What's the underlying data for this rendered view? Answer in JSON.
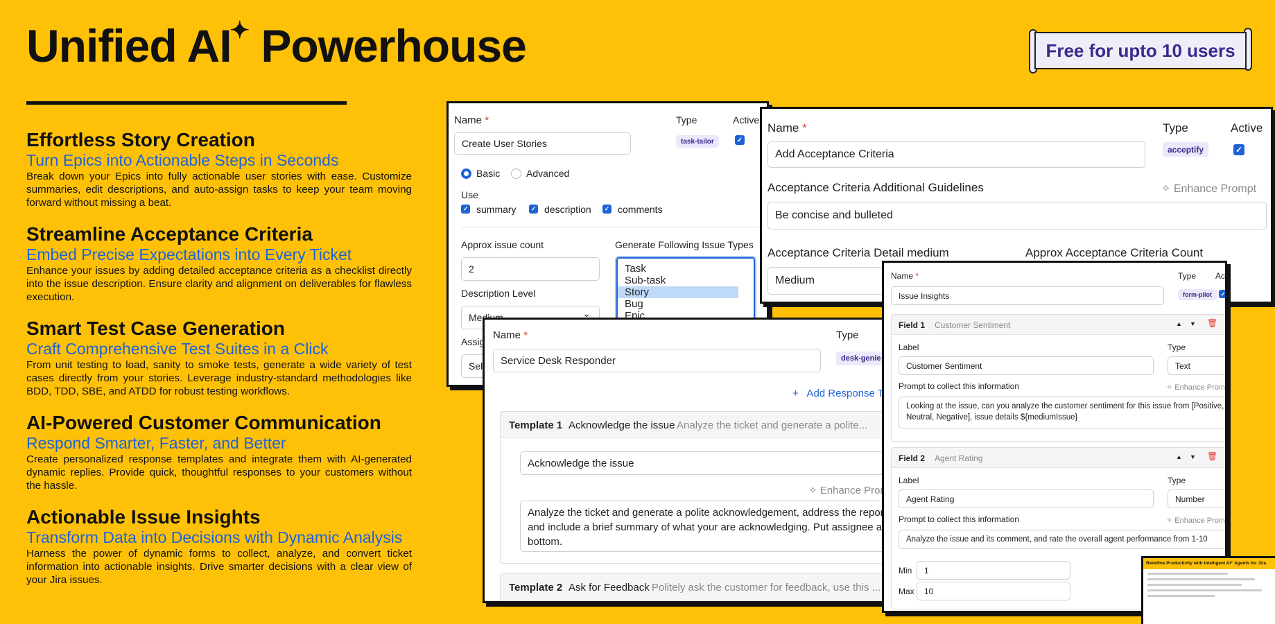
{
  "hero": {
    "title": "Unified AI",
    "sparkle": "✦",
    "title_suffix": " Powerhouse",
    "badge": "Free for upto 10 users"
  },
  "features": [
    {
      "title": "Effortless Story Creation",
      "subtitle": "Turn Epics into Actionable Steps in Seconds",
      "body": "Break down your Epics into fully actionable user stories with ease. Customize summaries, edit descriptions, and auto-assign tasks to keep your team moving forward without missing a beat."
    },
    {
      "title": "Streamline Acceptance Criteria",
      "subtitle": "Embed Precise Expectations into Every Ticket",
      "body": "Enhance your issues by adding detailed acceptance criteria as a checklist directly into the issue description. Ensure clarity and alignment on deliverables for flawless execution."
    },
    {
      "title": "Smart Test Case Generation",
      "subtitle": "Craft Comprehensive Test Suites in a Click",
      "body": "From unit testing to load, sanity to smoke tests, generate a wide variety of test cases directly from your stories. Leverage industry-standard methodologies like BDD, TDD, SBE, and ATDD for robust testing workflows."
    },
    {
      "title": "AI-Powered Customer Communication",
      "subtitle": "Respond Smarter, Faster, and Better",
      "body": "Create personalized response templates and integrate them with AI-generated dynamic replies. Provide quick, thoughtful responses to your customers without the hassle."
    },
    {
      "title": "Actionable Issue Insights",
      "subtitle": "Transform Data into Decisions with Dynamic Analysis",
      "body": "Harness the power of dynamic forms to collect, analyze, and convert ticket information into actionable insights. Drive smarter decisions with a clear view of your Jira issues."
    }
  ],
  "common": {
    "name_label": "Name",
    "required": "*",
    "type_label": "Type",
    "active_label": "Active",
    "check": "✓",
    "enhance_prompt": "Enhance Prompt",
    "sparkle_icon": "✧",
    "chevron": "⌄"
  },
  "story_card": {
    "name_value": "Create User Stories",
    "type_tag": "task-tailor",
    "mode_basic": "Basic",
    "mode_advanced": "Advanced",
    "use_label": "Use",
    "use_options": [
      "summary",
      "description",
      "comments"
    ],
    "approx_label": "Approx issue count",
    "approx_value": "2",
    "generate_label": "Generate Following Issue Types",
    "issue_types": [
      "Task",
      "Sub-task",
      "Story",
      "Bug",
      "Epic"
    ],
    "selected_issue_type": "Story",
    "desc_level_label": "Description Level",
    "desc_level_value": "Medium",
    "assign_label": "Assig",
    "assign_value": "Sel"
  },
  "acceptance_card": {
    "name_value": "Add Acceptance Criteria",
    "type_tag": "acceptify",
    "guidelines_label": "Acceptance Criteria Additional Guidelines",
    "guidelines_value": "Be concise and bulleted",
    "detail_label": "Acceptance Criteria Detail medium",
    "detail_value": "Medium",
    "count_label": "Approx Acceptance Criteria Count"
  },
  "desk_card": {
    "name_value": "Service Desk Responder",
    "type_tag": "desk-genie",
    "add_icon": "+",
    "add_link": "Add Response Te",
    "template1_label": "Template 1",
    "template1_title": "Acknowledge the issue",
    "template1_preview": "Analyze the ticket and generate a polite...",
    "template1_name_value": "Acknowledge the issue",
    "template1_prompt": "Analyze the ticket and generate a polite acknowledgement, address the reporter and include a brief summary of what your are acknowledging. Put assignee at the bottom.",
    "template2_label": "Template 2",
    "template2_title": "Ask for Feedback",
    "template2_preview": "Politely ask the customer for feedback, use this ..."
  },
  "insights_card": {
    "name_value": "Issue Insights",
    "type_tag": "form-pilot",
    "label_label": "Label",
    "prompt_label": "Prompt to collect this information",
    "up_icon": "▲",
    "down_icon": "▼",
    "trash_icon": "🗑",
    "field1_title": "Field 1",
    "field1_name": "Customer Sentiment",
    "field1_label_value": "Customer Sentiment",
    "field1_type": "Text",
    "field1_prompt": "Looking at the issue, can you analyze the customer sentiment for this issue from [Positive, Neutral, Negative], issue details ${mediumIssue}",
    "field2_title": "Field 2",
    "field2_name": "Agent Rating",
    "field2_label_value": "Agent Rating",
    "field2_type": "Number",
    "field2_prompt": "Analyze the issue and its comment, and rate the overall agent performance from 1-10",
    "min_label": "Min",
    "min_value": "1",
    "max_label": "Max",
    "max_value": "10"
  },
  "mini_doc": {
    "title": "Redefine Productivity with Intelligent AI⁺ Agents for Jira"
  },
  "colors": {
    "background": "#FFC107",
    "accent_blue": "#1E63D6",
    "tag_purple": "#3A2A8C",
    "required_red": "#E53935"
  }
}
